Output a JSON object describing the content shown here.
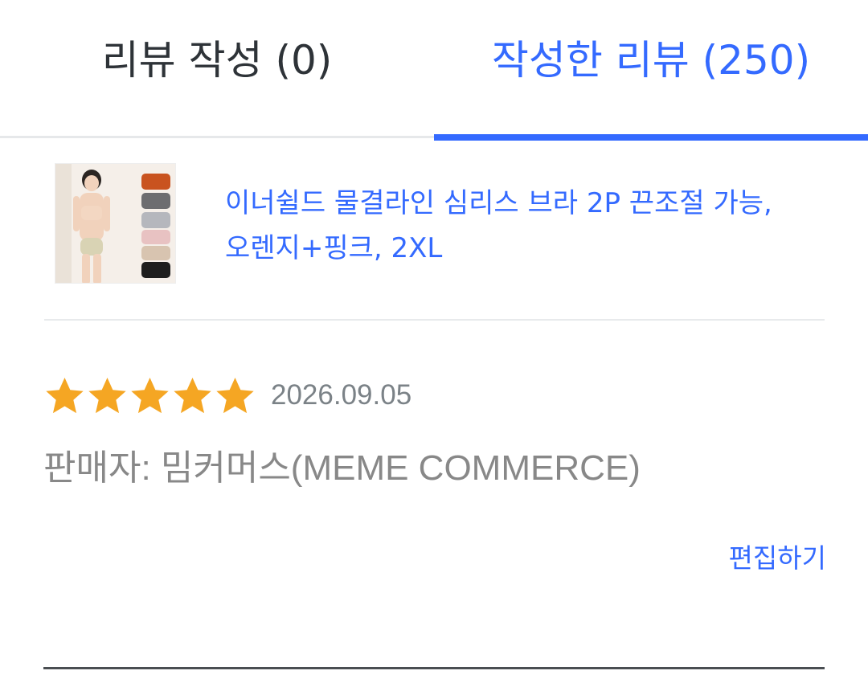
{
  "tabs": {
    "write": {
      "label": "리뷰 작성 (0)"
    },
    "written": {
      "label": "작성한 리뷰 (250)",
      "active": true
    }
  },
  "product": {
    "name": "이너쉴드 물결라인 심리스 브라 2P 끈조절 가능, 오렌지+핑크, 2XL",
    "thumbnail_icon": "product-photo"
  },
  "review": {
    "rating": 5,
    "rating_max": 5,
    "date": "2026.09.05",
    "seller": "판매자: 밈커머스(MEME COMMERCE)",
    "edit_label": "편집하기"
  },
  "colors": {
    "accent": "#346aff",
    "star": "#f5a623",
    "muted_text": "#888888"
  }
}
